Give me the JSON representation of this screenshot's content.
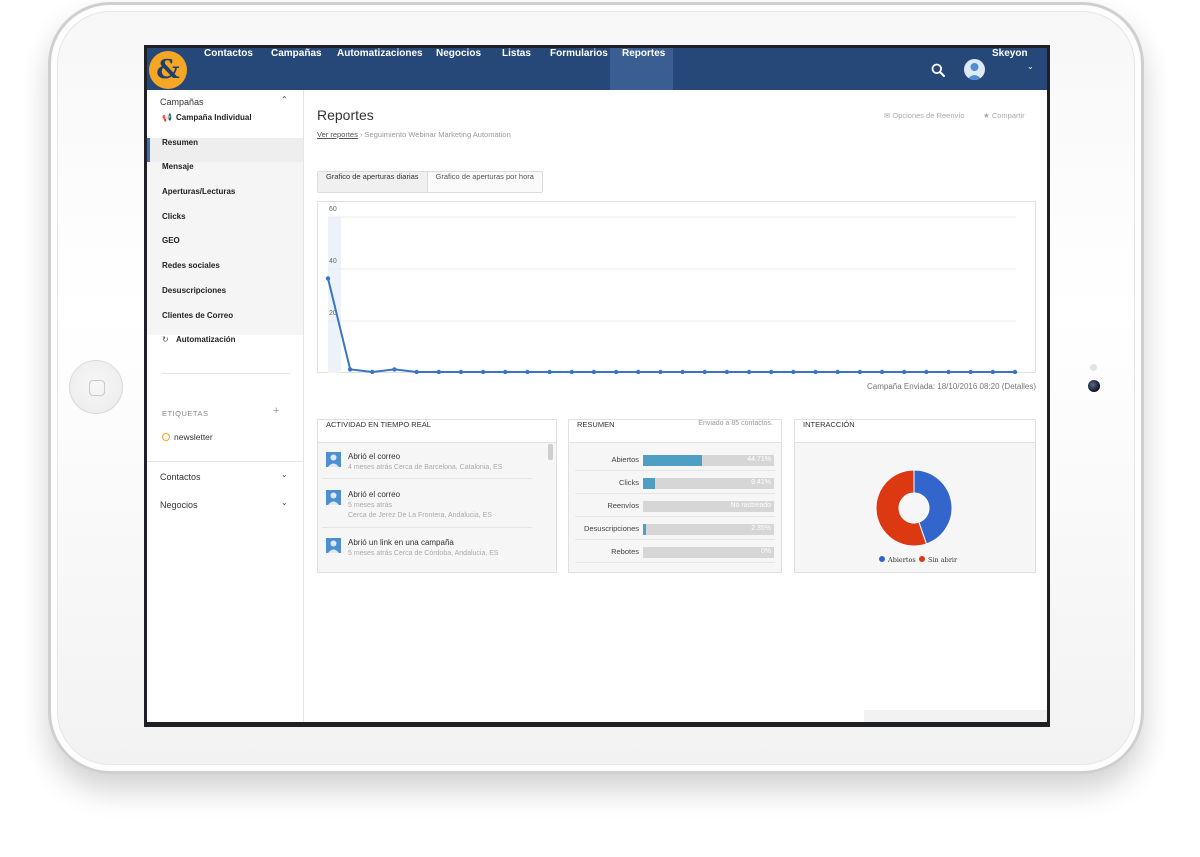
{
  "nav": {
    "logo": "&",
    "items": [
      {
        "label": "Contactos",
        "active": false
      },
      {
        "label": "Campañas",
        "active": false
      },
      {
        "label": "Automatizaciones",
        "active": false
      },
      {
        "label": "Negocios",
        "active": false
      },
      {
        "label": "Listas",
        "active": false
      },
      {
        "label": "Formularios",
        "active": false
      },
      {
        "label": "Reportes",
        "active": true
      }
    ],
    "user": "Skeyon"
  },
  "sidebar": {
    "section": "Campañas",
    "campaign_link": "Campaña Individual",
    "items": [
      {
        "label": "Resumen",
        "active": true
      },
      {
        "label": "Mensaje"
      },
      {
        "label": "Aperturas/Lecturas"
      },
      {
        "label": "Clicks"
      },
      {
        "label": "GEO"
      },
      {
        "label": "Redes sociales"
      },
      {
        "label": "Desuscripciones"
      },
      {
        "label": "Clientes de Correo"
      }
    ],
    "automation_link": "Automatización",
    "tags_label": "ETIQUETAS",
    "tags": [
      "newsletter"
    ],
    "bottom_sections": [
      "Contactos",
      "Negocios"
    ]
  },
  "main": {
    "title": "Reportes",
    "breadcrumb_link": "Ver reportes",
    "breadcrumb_current": "Seguimiento Webinar Marketing Automation",
    "actions": {
      "reenvio": "Opciones de Reenvío",
      "compartir": "Compartir"
    },
    "tabs": [
      {
        "label": "Grafico de aperturas diarias",
        "active": true
      },
      {
        "label": "Grafico de aperturas por hora",
        "active": false
      }
    ],
    "chart_caption": "Campaña Enviada: 18/10/2016 08:20 (Detalles)"
  },
  "chart_data": {
    "type": "line",
    "title": "",
    "xlabel": "",
    "ylabel": "",
    "ylim": [
      0,
      60
    ],
    "yticks": [
      "20",
      "40",
      "60"
    ],
    "series": [
      {
        "color": "#3a75c4",
        "values": [
          36,
          1,
          0,
          1,
          0,
          0,
          0,
          0,
          0,
          0,
          0,
          0,
          0,
          0,
          0,
          0,
          0,
          0,
          0,
          0,
          0,
          0,
          0,
          0,
          0,
          0,
          0,
          0,
          0,
          0,
          0,
          0
        ]
      }
    ],
    "grid": true
  },
  "actividad": {
    "header": "ACTIVIDAD EN TIEMPO REAL",
    "items": [
      {
        "title": "Abrió el correo",
        "meta": [
          "4 meses atrás  Cerca de Barcelona, Catalonia, ES"
        ]
      },
      {
        "title": "Abrió el correo",
        "meta": [
          "5 meses atrás",
          " Cerca de Jerez De La Frontera, Andalucia, ES"
        ]
      },
      {
        "title": "Abrió un link en una campaña",
        "meta": [
          "5 meses atrás  Cerca de Córdoba, Andalucia, ES"
        ]
      }
    ]
  },
  "resumen": {
    "header": "RESUMEN",
    "sent": "Enviado a 85 contactos.",
    "rows": [
      {
        "label": "Abiertos",
        "value": "44.71%",
        "fraction": 0.4471
      },
      {
        "label": "Clicks",
        "value": "9.41%",
        "fraction": 0.0941
      },
      {
        "label": "Reenvíos",
        "value": "No rastreado",
        "fraction": 0
      },
      {
        "label": "Desuscripciones",
        "value": "2.35%",
        "fraction": 0.0235
      },
      {
        "label": "Rebotes",
        "value": "0%",
        "fraction": 0
      }
    ]
  },
  "interaccion": {
    "header": "INTERACCIÓN",
    "slices": [
      {
        "label": "Abiertos",
        "fraction": 0.4471,
        "color": "#3366cc"
      },
      {
        "label": "Sin abrir",
        "fraction": 0.5529,
        "color": "#dc3912"
      }
    ]
  }
}
